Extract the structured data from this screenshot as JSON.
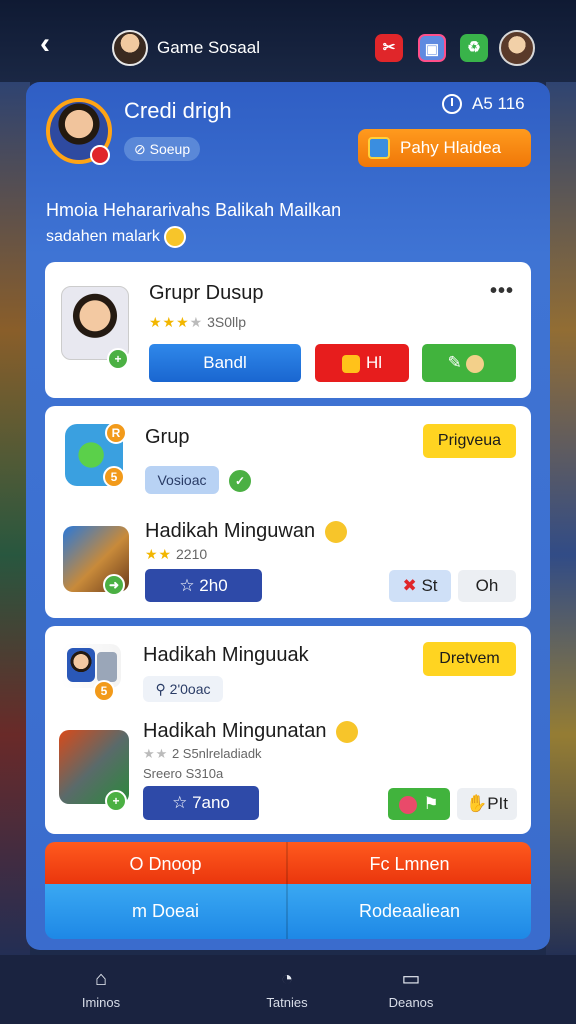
{
  "topbar": {
    "title": "Game Sosaal"
  },
  "profile": {
    "name": "Credi drigh",
    "tag": "Soeup",
    "score": "A5 116",
    "play_button": "Pahy Hlaidea"
  },
  "headline": "Hmoia Hehararivahs Balikah Mailkan",
  "subline": "sadahen malark",
  "card1": {
    "title": "Grupr Dusup",
    "rating": "3S0llp",
    "btn_blue": "Bandl",
    "btn_red": "Hl",
    "more": "•••"
  },
  "card2": {
    "item1_title": "Grup",
    "item1_chip": "Vosioac",
    "item1_action": "Prigveua",
    "item2_title": "Hadikah Minguwan",
    "item2_sub": "2210",
    "item2_btn": "2h0",
    "item2_btn_st": "St",
    "item2_btn_oh": "Oh"
  },
  "card3": {
    "item1_title": "Hadikah Minguuak",
    "item1_chip": "2'0oac",
    "item1_action": "Dretvem",
    "item2_title": "Hadikah Mingunatan",
    "item2_rating": "2 S5nlreladiadk",
    "item2_sub": "Sreero S310a",
    "item2_btn": "7ano",
    "item2_btn_pit": "PIt"
  },
  "actions": {
    "top_left": "O Dnoop",
    "top_right": "Fc Lmnen",
    "bottom_left": "m Doeai",
    "bottom_right": "Rodeaaliean"
  },
  "nav": {
    "item1": "Iminos",
    "item2": "Tatnies",
    "item3": "Deanos"
  },
  "colors": {
    "accent_orange": "#f07808",
    "panel_blue": "#3f74d4",
    "action_red": "#e9340c",
    "action_blue": "#1e88e6"
  }
}
